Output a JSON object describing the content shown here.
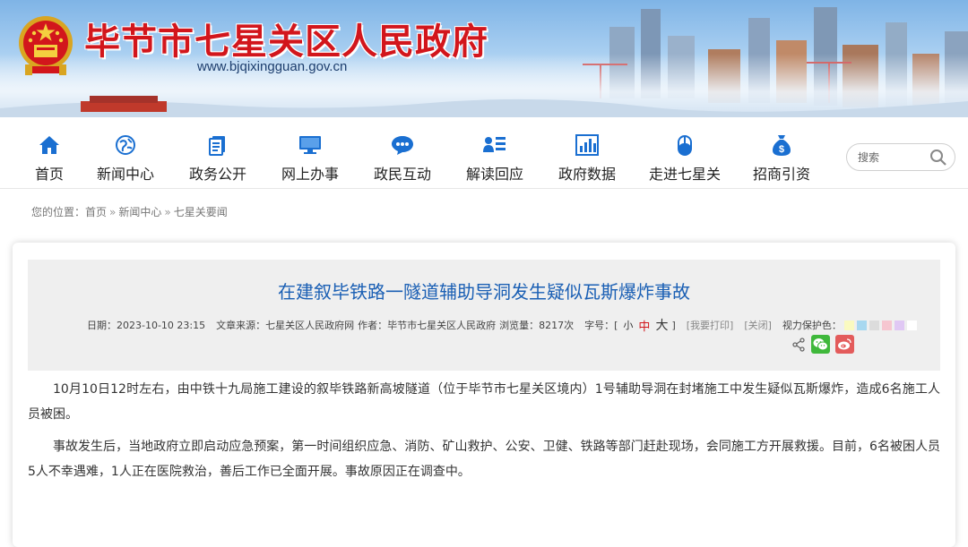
{
  "header": {
    "site_title": "毕节市七星关区人民政府",
    "site_url": "www.bjqixingguan.gov.cn",
    "emblem_icon": "national-emblem-icon",
    "title_color": "#d2161c"
  },
  "nav": {
    "items": [
      {
        "label": "首页",
        "icon": "home-icon"
      },
      {
        "label": "新闻中心",
        "icon": "globe-icon"
      },
      {
        "label": "政务公开",
        "icon": "document-icon"
      },
      {
        "label": "网上办事",
        "icon": "monitor-icon"
      },
      {
        "label": "政民互动",
        "icon": "chat-bubble-icon"
      },
      {
        "label": "解读回应",
        "icon": "person-list-icon"
      },
      {
        "label": "政府数据",
        "icon": "bar-chart-icon"
      },
      {
        "label": "走进七星关",
        "icon": "mouse-icon"
      },
      {
        "label": "招商引资",
        "icon": "money-bag-icon"
      }
    ],
    "icon_color": "#1a6fd1",
    "search_placeholder": "搜索"
  },
  "breadcrumb": {
    "prefix": "您的位置：",
    "items": [
      "首页",
      "新闻中心",
      "七星关要闻"
    ],
    "separator": "»"
  },
  "article": {
    "title": "在建叙毕铁路一隧道辅助导洞发生疑似瓦斯爆炸事故",
    "title_color": "#1a5fb4",
    "meta": {
      "date": "日期：2023-10-10 23:15",
      "source": "文章来源：七星关区人民政府网",
      "author": "作者：毕节市七星关区人民政府",
      "views": "浏览量：8217次",
      "font_size_label": "字号：[",
      "font_small": "小",
      "font_medium": "中",
      "font_large": "大",
      "font_close": "]",
      "print": "[我要打印]",
      "close": "[关闭]",
      "eye_care": "视力保护色："
    },
    "eye_care_colors": [
      "#fafac0",
      "#a8d8f0",
      "#dcdcdc",
      "#f6c6d0",
      "#e0c8f4",
      "#ffffff"
    ],
    "share": {
      "share_icon": "share-icon",
      "wechat_icon": "wechat-icon",
      "wechat_color": "#3fb83b",
      "weibo_icon": "weibo-icon",
      "weibo_color": "#e35b5b"
    },
    "paragraphs": [
      "10月10日12时左右，由中铁十九局施工建设的叙毕铁路新高坡隧道（位于毕节市七星关区境内）1号辅助导洞在封堵施工中发生疑似瓦斯爆炸，造成6名施工人员被困。",
      "事故发生后，当地政府立即启动应急预案，第一时间组织应急、消防、矿山救护、公安、卫健、铁路等部门赶赴现场，会同施工方开展救援。目前，6名被困人员5人不幸遇难，1人正在医院救治，善后工作已全面开展。事故原因正在调查中。"
    ]
  }
}
